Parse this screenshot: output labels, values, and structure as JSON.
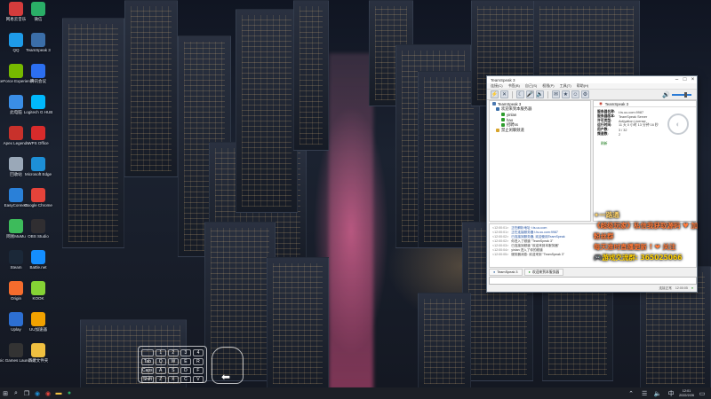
{
  "desktop": {
    "icons": [
      {
        "label": "网易云音乐",
        "icon": "music-icon",
        "color": "#d43c3c"
      },
      {
        "label": "QQ",
        "icon": "qq-icon",
        "color": "#1e9be9"
      },
      {
        "label": "GeForce Experience",
        "icon": "nvidia-icon",
        "color": "#76b900"
      },
      {
        "label": "此电脑",
        "icon": "computer-icon",
        "color": "#3a8ee6"
      },
      {
        "label": "Apex Legends",
        "icon": "apex-icon",
        "color": "#c8312b"
      },
      {
        "label": "回收站",
        "icon": "recycle-bin-icon",
        "color": "#9aa8b8"
      },
      {
        "label": "EasyConnect",
        "icon": "vpn-icon",
        "color": "#2a80d8"
      },
      {
        "label": "网易MuMu",
        "icon": "emulator-icon",
        "color": "#3dbb5b"
      },
      {
        "label": "Steam",
        "icon": "steam-icon",
        "color": "#1b2838"
      },
      {
        "label": "Origin",
        "icon": "origin-icon",
        "color": "#f56c2d"
      },
      {
        "label": "Uplay",
        "icon": "uplay-icon",
        "color": "#2d6fd2"
      },
      {
        "label": "Epic Games Launcher",
        "icon": "epic-icon",
        "color": "#333333"
      },
      {
        "label": "微信",
        "icon": "wechat-icon",
        "color": "#2aae67"
      },
      {
        "label": "TeamSpeak 3",
        "icon": "teamspeak-icon",
        "color": "#3b6ea8"
      },
      {
        "label": "腾讯会议",
        "icon": "meeting-icon",
        "color": "#2c6ff0"
      },
      {
        "label": "Logitech G HUB",
        "icon": "logitech-icon",
        "color": "#00b8fc"
      },
      {
        "label": "WPS Office",
        "icon": "wps-icon",
        "color": "#d82b2b"
      },
      {
        "label": "Microsoft Edge",
        "icon": "edge-icon",
        "color": "#1d8fd6"
      },
      {
        "label": "Google Chrome",
        "icon": "chrome-icon",
        "color": "#e5433a"
      },
      {
        "label": "OBS Studio",
        "icon": "obs-icon",
        "color": "#302e31"
      },
      {
        "label": "Battle.net",
        "icon": "battlenet-icon",
        "color": "#148eff"
      },
      {
        "label": "KOOK",
        "icon": "kook-icon",
        "color": "#85d235"
      },
      {
        "label": "UU加速器",
        "icon": "uu-icon",
        "color": "#f2a200"
      },
      {
        "label": "新建文件夹",
        "icon": "folder-icon",
        "color": "#f0c040"
      }
    ]
  },
  "teamspeak": {
    "title": "TeamSpeak 3",
    "menu": [
      "连接(C)",
      "书签(B)",
      "自己(S)",
      "权限(P)",
      "工具(T)",
      "帮助(H)"
    ],
    "tree": [
      {
        "label": "TeamSpeak 3",
        "color": "#4a78b0",
        "indent": 0
      },
      {
        "label": "欢迎来到本服务器",
        "color": "#3b6ea8",
        "indent": 4
      },
      {
        "label": "yinlan",
        "color": "#2e9d2e",
        "indent": 10
      },
      {
        "label": "hao",
        "color": "#2e9d2e",
        "indent": 10
      },
      {
        "label": "招聘ss",
        "color": "#2e9d2e",
        "indent": 10
      },
      {
        "label": "禁止闲聊频道",
        "color": "#d7a42c",
        "indent": 4
      }
    ],
    "info_tab": "TeamSpeak 3",
    "info": [
      {
        "k": "服务器名称:",
        "v": "t.ts.uu.com:9987"
      },
      {
        "k": "服务器版本:",
        "v": "TeamSpeak Server"
      },
      {
        "k": "许可类型:",
        "v": "Activation License"
      },
      {
        "k": "运行时间:",
        "v": "11 天 0 小时 13 分钟 16 秒"
      },
      {
        "k": "用户数:",
        "v": "3 / 32"
      },
      {
        "k": "频道数:",
        "v": "2"
      }
    ],
    "info_link": "刷新",
    "log": [
      {
        "t": "<12:00:01>",
        "text": "正在解析地址 t.ts.uu.com",
        "blue": true
      },
      {
        "t": "<12:00:01>",
        "text": "正在连接服务器 t.ts.uu.com:9987",
        "blue": true
      },
      {
        "t": "<12:00:02>",
        "text": "已连接到服务器, 欢迎使用TeamSpeak",
        "blue": true
      },
      {
        "t": "<12:00:02>",
        "text": "你进入了频道 \"TeamSpeak 3\"",
        "blue": false
      },
      {
        "t": "<12:00:03>",
        "text": "已连接到频道 \"欢迎来到本服务器\"",
        "blue": false
      },
      {
        "t": "<12:00:04>",
        "text": "yinlan 进入了你的频道",
        "blue": false
      },
      {
        "t": "<12:00:05>",
        "text": "服务器消息: 欢迎来到 \"TeamSpeak 3\"",
        "blue": false
      }
    ],
    "tabs": [
      "TeamSpeak 3",
      "欢迎来到本服务器"
    ],
    "status": [
      "连接正常",
      "12:00:05"
    ]
  },
  "overlay": {
    "line1": "✦一路通",
    "line2": "《超级玩家》私信我获取源码 ♥ 加粉丝群",
    "line3": "每天准时直播更新 ! ❤ 关注",
    "line4": "🎮游戏交流群: 365025066"
  },
  "osk_keys": [
    "`",
    "1",
    "2",
    "3",
    "4",
    "Tab",
    "Q",
    "W",
    "E",
    "R",
    "Caps",
    "A",
    "S",
    "D",
    "F",
    "Shift",
    "Z",
    "X",
    "C",
    "V"
  ],
  "taskbar": {
    "time": "12:01",
    "date": "2022/2/26",
    "lang": "中",
    "icons": [
      "start-icon",
      "search-icon",
      "task-view-icon",
      "edge-icon",
      "chrome-icon",
      "explorer-icon",
      "wechat-icon"
    ]
  }
}
